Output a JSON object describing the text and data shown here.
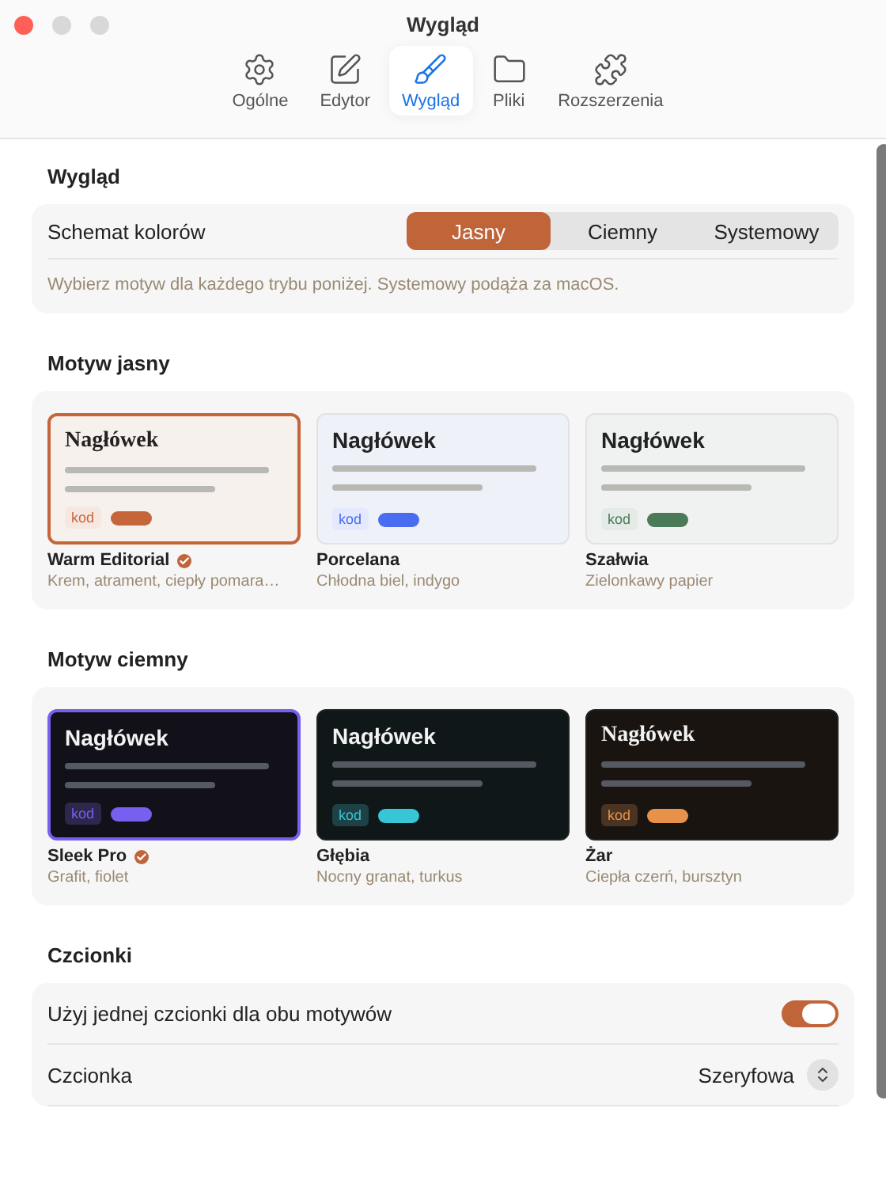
{
  "window": {
    "title": "Wygląd"
  },
  "toolbar": [
    {
      "label": "Ogólne",
      "kind": "gear",
      "selected": false
    },
    {
      "label": "Edytor",
      "kind": "edit",
      "selected": false
    },
    {
      "label": "Wygląd",
      "kind": "brush",
      "selected": true
    },
    {
      "label": "Pliki",
      "kind": "folder",
      "selected": false
    },
    {
      "label": "Rozszerzenia",
      "kind": "puzzle",
      "selected": false
    }
  ],
  "appearance": {
    "heading": "Wygląd",
    "label": "Schemat kolorów",
    "options": [
      {
        "label": "Jasny",
        "selected": true
      },
      {
        "label": "Ciemny",
        "selected": false
      },
      {
        "label": "Systemowy",
        "selected": false
      }
    ],
    "hint": "Wybierz motyw dla każdego trybu poniżej. Systemowy podąża za macOS."
  },
  "theme_groups": [
    {
      "heading": "Motyw jasny",
      "kind": "light",
      "themes": [
        {
          "name": "Warm Editorial",
          "description": "Krem, atrament, ciepły pomara…",
          "preview_heading": "Nagłówek",
          "tag": "kod",
          "color": "#c4653a",
          "serif": true,
          "selected": true
        },
        {
          "name": "Porcelana",
          "description": "Chłodna biel, indygo",
          "preview_heading": "Nagłówek",
          "tag": "kod",
          "color": "#4a6cf0",
          "serif": false,
          "selected": false
        },
        {
          "name": "Szałwia",
          "description": "Zielonkawy papier",
          "preview_heading": "Nagłówek",
          "tag": "kod",
          "color": "#4a7a58",
          "serif": false,
          "selected": false
        }
      ]
    },
    {
      "heading": "Motyw ciemny",
      "kind": "dark",
      "themes": [
        {
          "name": "Sleek Pro",
          "description": "Grafit, fiolet",
          "preview_heading": "Nagłówek",
          "tag": "kod",
          "color": "#7560f0",
          "serif": false,
          "selected": true
        },
        {
          "name": "Głębia",
          "description": "Nocny granat, turkus",
          "preview_heading": "Nagłówek",
          "tag": "kod",
          "color": "#38c6d6",
          "serif": false,
          "selected": false
        },
        {
          "name": "Żar",
          "description": "Ciepła czerń, bursztyn",
          "preview_heading": "Nagłówek",
          "tag": "kod",
          "color": "#e8914a",
          "serif": true,
          "selected": false
        }
      ]
    }
  ],
  "fonts": {
    "heading": "Czcionki",
    "toggle": {
      "label": "Użyj jednej czcionki dla obu motywów",
      "on": true
    },
    "select": {
      "label": "Czcionka",
      "value": "Szeryfowa"
    }
  }
}
